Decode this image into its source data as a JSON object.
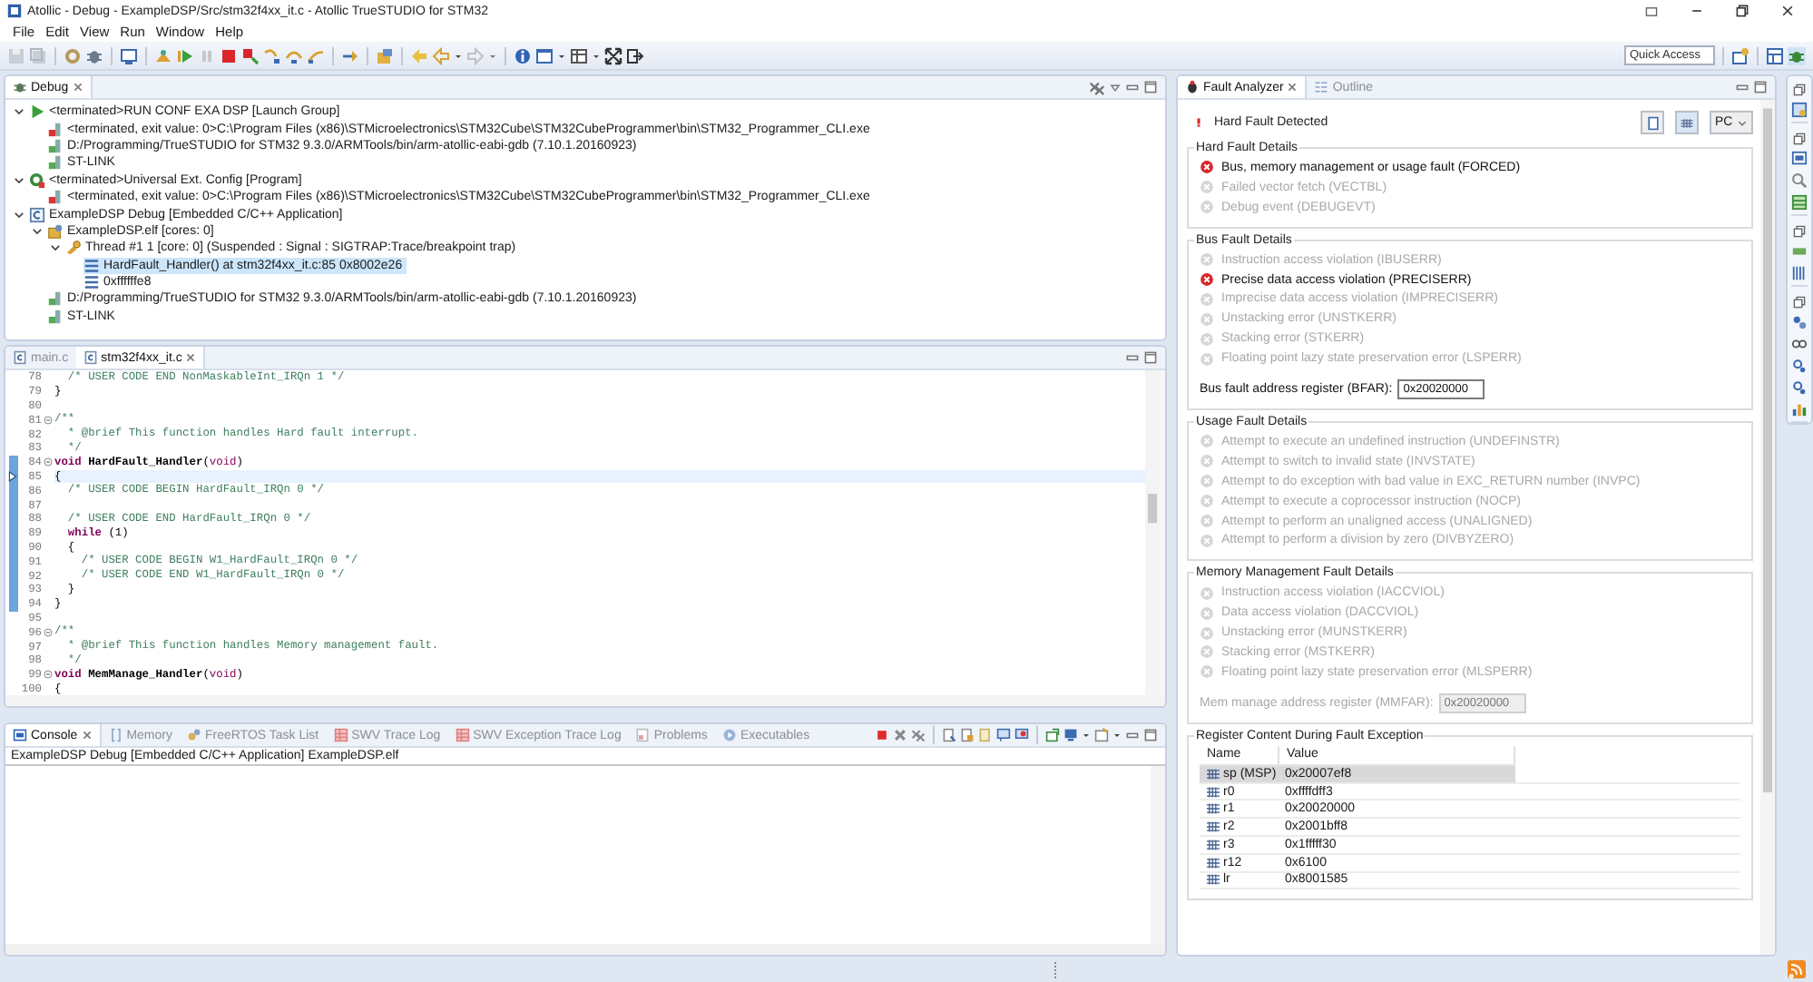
{
  "window": {
    "title": "Atollic - Debug - ExampleDSP/Src/stm32f4xx_it.c - Atollic TrueSTUDIO for STM32"
  },
  "menu": [
    "File",
    "Edit",
    "View",
    "Run",
    "Window",
    "Help"
  ],
  "quick_access": {
    "placeholder": "Quick Access"
  },
  "debug_view": {
    "tab": {
      "label": "Debug",
      "selected": true
    },
    "tree": [
      {
        "kind": "launch-group",
        "label": "<terminated>RUN CONF EXA DSP [Launch Group]",
        "expanded": true,
        "selected": false,
        "children": [
          {
            "kind": "terminated-process",
            "label": "<terminated, exit value: 0>C:\\Program Files (x86)\\STMicroelectronics\\STM32Cube\\STM32CubeProgrammer\\bin\\STM32_Programmer_CLI.exe",
            "selected": false
          },
          {
            "kind": "process",
            "label": "D:/Programming/TrueSTUDIO for STM32 9.3.0/ARMTools/bin/arm-atollic-eabi-gdb (7.10.1.20160923)",
            "selected": false
          },
          {
            "kind": "process",
            "label": "ST-LINK",
            "selected": false
          }
        ]
      },
      {
        "kind": "config",
        "label": "<terminated>Universal Ext. Config [Program]",
        "expanded": true,
        "selected": false,
        "children": [
          {
            "kind": "terminated-process",
            "label": "<terminated, exit value: 0>C:\\Program Files (x86)\\STMicroelectronics\\STM32Cube\\STM32CubeProgrammer\\bin\\STM32_Programmer_CLI.exe",
            "selected": false
          }
        ]
      },
      {
        "kind": "application",
        "label": "ExampleDSP Debug [Embedded C/C++ Application]",
        "expanded": true,
        "selected": false,
        "children": [
          {
            "kind": "elf",
            "label": "ExampleDSP.elf [cores: 0]",
            "expanded": true,
            "selected": false,
            "children": [
              {
                "kind": "thread",
                "label": "Thread #1 1 [core: 0] (Suspended : Signal : SIGTRAP:Trace/breakpoint trap)",
                "expanded": true,
                "selected": false,
                "children": [
                  {
                    "kind": "frame",
                    "label": "HardFault_Handler() at stm32f4xx_it.c:85 0x8002e26",
                    "selected": true
                  },
                  {
                    "kind": "frame",
                    "label": "0xffffffe8",
                    "selected": false
                  }
                ]
              }
            ]
          },
          {
            "kind": "process",
            "label": "D:/Programming/TrueSTUDIO for STM32 9.3.0/ARMTools/bin/arm-atollic-eabi-gdb (7.10.1.20160923)",
            "selected": false
          },
          {
            "kind": "process",
            "label": "ST-LINK",
            "selected": false
          }
        ]
      }
    ]
  },
  "editor": {
    "tabs": [
      {
        "label": "main.c",
        "selected": false
      },
      {
        "label": "stm32f4xx_it.c",
        "selected": true
      }
    ],
    "lines": [
      {
        "number": "78",
        "fold": false,
        "current": false,
        "marked": false,
        "segments": [
          {
            "text": "  /* USER CODE END NonMaskableInt_IRQn 1 */",
            "kind": "comment"
          }
        ]
      },
      {
        "number": "79",
        "fold": false,
        "current": false,
        "marked": false,
        "segments": [
          {
            "text": "}",
            "kind": "plain"
          }
        ]
      },
      {
        "number": "80",
        "fold": false,
        "current": false,
        "marked": false
      },
      {
        "number": "81",
        "fold": true,
        "current": false,
        "marked": false,
        "segments": [
          {
            "text": "/**",
            "kind": "comment"
          }
        ]
      },
      {
        "number": "82",
        "fold": false,
        "current": false,
        "marked": false,
        "segments": [
          {
            "text": "  * @brief This function handles Hard fault interrupt.",
            "kind": "comment"
          }
        ]
      },
      {
        "number": "83",
        "fold": false,
        "current": false,
        "marked": false,
        "segments": [
          {
            "text": "  */",
            "kind": "comment"
          }
        ]
      },
      {
        "number": "84",
        "fold": true,
        "current": false,
        "marked": true,
        "segments": [
          {
            "text": "void",
            "kind": "keyword"
          },
          {
            "text": " HardFault_Handler",
            "kind": "bold"
          },
          {
            "text": "(",
            "kind": "plain"
          },
          {
            "text": "void",
            "kind": "keyword-light"
          },
          {
            "text": ")",
            "kind": "plain"
          }
        ]
      },
      {
        "number": "85",
        "fold": false,
        "current": true,
        "marked": true,
        "segments": [
          {
            "text": "{",
            "kind": "plain"
          }
        ]
      },
      {
        "number": "86",
        "fold": false,
        "current": false,
        "marked": true,
        "segments": [
          {
            "text": "  /* USER CODE BEGIN HardFault_IRQn 0 */",
            "kind": "comment"
          }
        ]
      },
      {
        "number": "87",
        "fold": false,
        "current": false,
        "marked": true
      },
      {
        "number": "88",
        "fold": false,
        "current": false,
        "marked": true,
        "segments": [
          {
            "text": "  /* USER CODE END HardFault_IRQn 0 */",
            "kind": "comment"
          }
        ]
      },
      {
        "number": "89",
        "fold": false,
        "current": false,
        "marked": true,
        "segments": [
          {
            "text": "  while",
            "kind": "keyword"
          },
          {
            "text": " (1)",
            "kind": "plain"
          }
        ]
      },
      {
        "number": "90",
        "fold": false,
        "current": false,
        "marked": true,
        "segments": [
          {
            "text": "  {",
            "kind": "plain"
          }
        ]
      },
      {
        "number": "91",
        "fold": false,
        "current": false,
        "marked": true,
        "segments": [
          {
            "text": "    /* USER CODE BEGIN W1_HardFault_IRQn 0 */",
            "kind": "comment"
          }
        ]
      },
      {
        "number": "92",
        "fold": false,
        "current": false,
        "marked": true,
        "segments": [
          {
            "text": "    /* USER CODE END W1_HardFault_IRQn 0 */",
            "kind": "comment"
          }
        ]
      },
      {
        "number": "93",
        "fold": false,
        "current": false,
        "marked": true,
        "segments": [
          {
            "text": "  }",
            "kind": "plain"
          }
        ]
      },
      {
        "number": "94",
        "fold": false,
        "current": false,
        "marked": true,
        "segments": [
          {
            "text": "}",
            "kind": "plain"
          }
        ]
      },
      {
        "number": "95",
        "fold": false,
        "current": false,
        "marked": false
      },
      {
        "number": "96",
        "fold": true,
        "current": false,
        "marked": false,
        "segments": [
          {
            "text": "/**",
            "kind": "comment"
          }
        ]
      },
      {
        "number": "97",
        "fold": false,
        "current": false,
        "marked": false,
        "segments": [
          {
            "text": "  * @brief This function handles Memory management fault.",
            "kind": "comment"
          }
        ]
      },
      {
        "number": "98",
        "fold": false,
        "current": false,
        "marked": false,
        "segments": [
          {
            "text": "  */",
            "kind": "comment"
          }
        ]
      },
      {
        "number": "99",
        "fold": true,
        "current": false,
        "marked": false,
        "segments": [
          {
            "text": "void",
            "kind": "keyword"
          },
          {
            "text": " MemManage_Handler",
            "kind": "bold"
          },
          {
            "text": "(",
            "kind": "plain"
          },
          {
            "text": "void",
            "kind": "keyword-light"
          },
          {
            "text": ")",
            "kind": "plain"
          }
        ]
      },
      {
        "number": "100",
        "fold": false,
        "current": false,
        "marked": false,
        "segments": [
          {
            "text": "{",
            "kind": "plain"
          }
        ]
      }
    ]
  },
  "console": {
    "tabs": [
      {
        "label": "Console",
        "selected": true
      },
      {
        "label": "Memory",
        "selected": false
      },
      {
        "label": "FreeRTOS Task List",
        "selected": false
      },
      {
        "label": "SWV Trace Log",
        "selected": false
      },
      {
        "label": "SWV Exception Trace Log",
        "selected": false
      },
      {
        "label": "Problems",
        "selected": false
      },
      {
        "label": "Executables",
        "selected": false
      }
    ],
    "title": "ExampleDSP Debug [Embedded C/C++ Application] ExampleDSP.elf"
  },
  "fault_analyzer": {
    "tabs": [
      {
        "label": "Fault Analyzer",
        "selected": true
      },
      {
        "label": "Outline",
        "selected": false
      }
    ],
    "status": "Hard Fault Detected",
    "selector": "PC",
    "groups": [
      {
        "title": "Hard Fault Details",
        "items": [
          {
            "label": "Bus, memory management or usage fault (FORCED)",
            "active": true
          },
          {
            "label": "Failed vector fetch (VECTBL)",
            "active": false
          },
          {
            "label": "Debug event (DEBUGEVT)",
            "active": false
          }
        ]
      },
      {
        "title": "Bus Fault Details",
        "items": [
          {
            "label": "Instruction access violation (IBUSERR)",
            "active": false
          },
          {
            "label": "Precise data access violation (PRECISERR)",
            "active": true
          },
          {
            "label": "Imprecise data access violation (IMPRECISERR)",
            "active": false
          },
          {
            "label": "Unstacking error (UNSTKERR)",
            "active": false
          },
          {
            "label": "Stacking error (STKERR)",
            "active": false
          },
          {
            "label": "Floating point lazy state preservation error (LSPERR)",
            "active": false
          }
        ],
        "register": {
          "label": "Bus fault address register (BFAR):",
          "value": "0x20020000",
          "disabled": false
        }
      },
      {
        "title": "Usage Fault Details",
        "items": [
          {
            "label": "Attempt to execute an undefined instruction (UNDEFINSTR)",
            "active": false
          },
          {
            "label": "Attempt to switch to invalid state (INVSTATE)",
            "active": false
          },
          {
            "label": "Attempt to do exception with bad value in EXC_RETURN number (INVPC)",
            "active": false
          },
          {
            "label": "Attempt to execute a coprocessor instruction (NOCP)",
            "active": false
          },
          {
            "label": "Attempt to perform an unaligned access (UNALIGNED)",
            "active": false
          },
          {
            "label": "Attempt to perform a division by zero (DIVBYZERO)",
            "active": false
          }
        ]
      },
      {
        "title": "Memory Management Fault Details",
        "items": [
          {
            "label": "Instruction access violation (IACCVIOL)",
            "active": false
          },
          {
            "label": "Data access violation (DACCVIOL)",
            "active": false
          },
          {
            "label": "Unstacking error (MUNSTKERR)",
            "active": false
          },
          {
            "label": "Stacking error (MSTKERR)",
            "active": false
          },
          {
            "label": "Floating point lazy state preservation error (MLSPERR)",
            "active": false
          }
        ],
        "register": {
          "label": "Mem manage address register (MMFAR):",
          "value": "0x20020000",
          "disabled": true
        }
      }
    ],
    "registers": {
      "title": "Register Content During Fault Exception",
      "columns": [
        "Name",
        "Value"
      ],
      "rows": [
        {
          "name": "sp (MSP)",
          "value": "0x20007ef8",
          "selected": true
        },
        {
          "name": "r0",
          "value": "0xffffdff3",
          "selected": false
        },
        {
          "name": "r1",
          "value": "0x20020000",
          "selected": false
        },
        {
          "name": "r2",
          "value": "0x2001bff8",
          "selected": false
        },
        {
          "name": "r3",
          "value": "0x1fffff30",
          "selected": false
        },
        {
          "name": "r12",
          "value": "0x6100",
          "selected": false
        },
        {
          "name": "lr",
          "value": "0x8001585",
          "selected": false
        }
      ]
    }
  }
}
